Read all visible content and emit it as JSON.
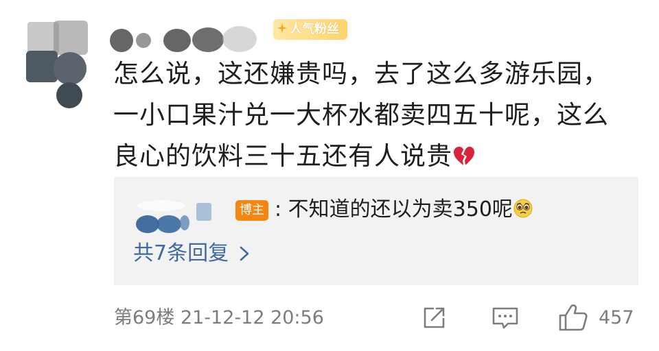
{
  "comment": {
    "fan_badge_label": "人气粉丝",
    "text_line1": "怎么说，这还嫌贵吗，去了这么多游乐园，",
    "text_line2": "一小口果汁兑一大杯水都卖四五十呢，这么",
    "text_line3": "良心的饮料三十五还有人说贵",
    "emoji_name": "broken-heart-icon"
  },
  "reply": {
    "author_badge_label": "博主",
    "text": ": 不知道的还以为卖350呢",
    "emoji_name": "pleading-face-icon",
    "more_replies_label": "共7条回复"
  },
  "footer": {
    "floor_and_time": "第69楼  21-12-12 20:56",
    "like_count": "457",
    "icons": [
      "share-icon",
      "comment-icon",
      "like-icon"
    ]
  },
  "colors": {
    "link_blue": "#3e6aa3",
    "author_badge": "#f5860f",
    "muted_text": "#7d7d7d",
    "reply_bg": "#f2f2f2"
  }
}
